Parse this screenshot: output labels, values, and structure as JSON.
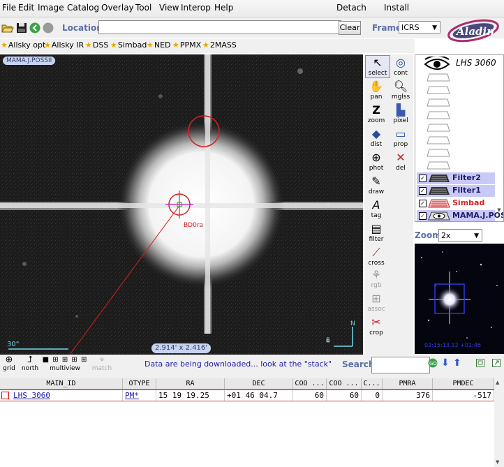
{
  "menu": [
    "File",
    "Edit",
    "Image",
    "Catalog",
    "Overlay",
    "Tool",
    "View",
    "Interop",
    "Help"
  ],
  "menu_right": {
    "detach": "Detach",
    "install": "Install"
  },
  "toolbar": {
    "location_label": "Location",
    "location_value": "",
    "clear_label": "Clear",
    "frame_label": "Frame",
    "frame_value": "ICRS"
  },
  "bookmarks": [
    "Allsky opt",
    "Allsky IR",
    "DSS",
    "Simbad",
    "NED",
    "PPMX",
    "2MASS"
  ],
  "view": {
    "survey_label": "MAMA.J.POSSII",
    "fov_label": "2.914' x 2.416'",
    "scale_label": "30\"",
    "source_label": "BD0ra",
    "compass_n": "N",
    "compass_e": "E"
  },
  "tools": [
    {
      "icon": "arrow-select-icon",
      "label": "select"
    },
    {
      "icon": "contour-icon",
      "label": "cont"
    },
    {
      "icon": "hand-icon",
      "label": "pan"
    },
    {
      "icon": "magnifier-icon",
      "label": "mglss"
    },
    {
      "icon": "zoom-z-icon",
      "label": "zoom"
    },
    {
      "icon": "pixel-icon",
      "label": "pixel"
    },
    {
      "icon": "dist-icon",
      "label": "dist"
    },
    {
      "icon": "prop-icon",
      "label": "prop"
    },
    {
      "icon": "phot-icon",
      "label": "phot"
    },
    {
      "icon": "delete-x-icon",
      "label": "del"
    },
    {
      "icon": "pencil-icon",
      "label": "draw"
    },
    {
      "icon": "tag-icon",
      "label": "tag"
    },
    {
      "icon": "filter-icon",
      "label": "filter"
    },
    {
      "icon": "cross-icon",
      "label": "cross"
    },
    {
      "icon": "rgb-icon",
      "label": "rgb"
    },
    {
      "icon": "assoc-icon",
      "label": "assoc"
    },
    {
      "icon": "scissors-icon",
      "label": "crop"
    }
  ],
  "stack": {
    "target": "LHS 3060",
    "planes": [
      {
        "name": "Filter2",
        "checked": true
      },
      {
        "name": "Filter1",
        "checked": true
      },
      {
        "name": "Simbad",
        "checked": true,
        "color": "#d62020"
      },
      {
        "name": "MAMA.J.POSSII",
        "checked": true
      }
    ]
  },
  "zoom": {
    "label": "Zoom",
    "value": "2x"
  },
  "zoomview_coords": "02:15:13.12 +01:46",
  "controls": [
    {
      "icon": "grid-icon",
      "label": "grid"
    },
    {
      "icon": "north-icon",
      "label": "north"
    },
    {
      "icon": "multiview-icon",
      "label": "multiview"
    },
    {
      "icon": "match-icon",
      "label": "match"
    }
  ],
  "status_message": "Data are being downloaded... look at the \"stack\"",
  "search": {
    "label": "Search",
    "value": ""
  },
  "table": {
    "headers": [
      "MAIN_ID",
      "OTYPE",
      "RA",
      "DEC",
      "COO ...",
      "COO ...",
      "C...",
      "PMRA",
      "PMDEC"
    ],
    "rows": [
      [
        "LHS  3060",
        "PM*",
        "15 19 19.25",
        "+01 46 04.7",
        "60",
        "60",
        "0",
        "376",
        "-517"
      ]
    ]
  },
  "colors": {
    "accent": "#5a6fa6",
    "plane_bg": "#c9c9f7",
    "overlay_red": "#d62020",
    "status_blue": "#1a1ab0"
  }
}
